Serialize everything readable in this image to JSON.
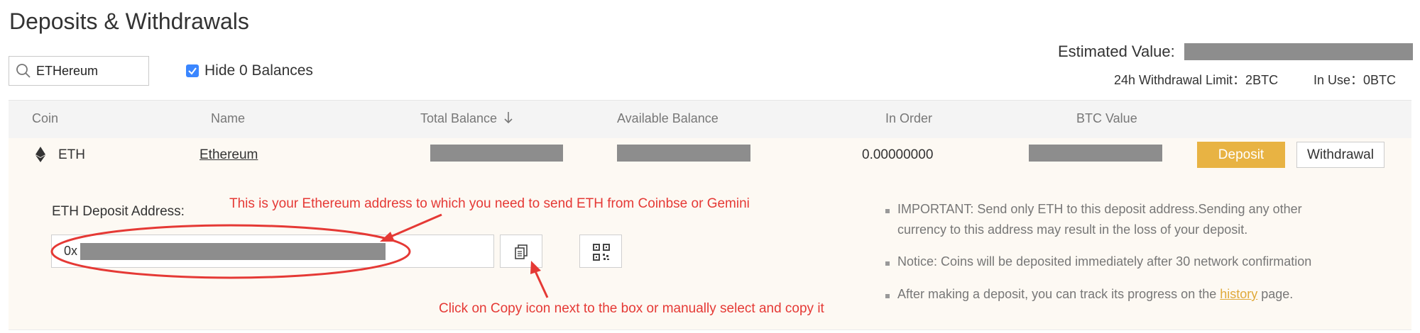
{
  "page": {
    "title": "Deposits & Withdrawals"
  },
  "filters": {
    "search_value": "ETHereum",
    "hide_zero_label": "Hide 0 Balances",
    "hide_zero_checked": true
  },
  "summary": {
    "estimated_value_label": "Estimated Value:",
    "withdrawal_limit_text": "24h Withdrawal Limit：2BTC",
    "in_use_text": "In Use：0BTC"
  },
  "table": {
    "columns": [
      "Coin",
      "Name",
      "Total Balance",
      "Available Balance",
      "In Order",
      "BTC Value"
    ],
    "sort_icon": "arrow-down-icon",
    "row": {
      "coin": "ETH",
      "coin_icon": "ethereum-icon",
      "name": "Ethereum",
      "in_order": "0.00000000",
      "deposit_label": "Deposit",
      "withdrawal_label": "Withdrawal"
    }
  },
  "deposit_panel": {
    "address_label": "ETH Deposit Address:",
    "address_prefix": "0x",
    "copy_icon": "copy-icon",
    "qr_icon": "qr-code-icon",
    "notes": [
      {
        "text": "IMPORTANT: Send only ETH to this deposit address.Sending any other"
      },
      {
        "text": "currency to this address may result in the loss of your deposit."
      },
      {
        "text": "Notice: Coins will be deposited immediately after 30 network confirmation"
      },
      {
        "before": "After making a deposit, you can track its progress on the ",
        "link": "history",
        "after": " page."
      }
    ]
  },
  "annotations": {
    "address_hint": "This is your Ethereum address to which you need to send ETH from Coinbse or Gemini",
    "copy_hint": "Click on Copy icon next to the box or manually select and copy it",
    "color": "#e53935"
  },
  "colors": {
    "accent": "#e8b343",
    "checkbox": "#3a86ff",
    "row_background": "#fdf9f3",
    "redaction": "#8d8d8d"
  }
}
